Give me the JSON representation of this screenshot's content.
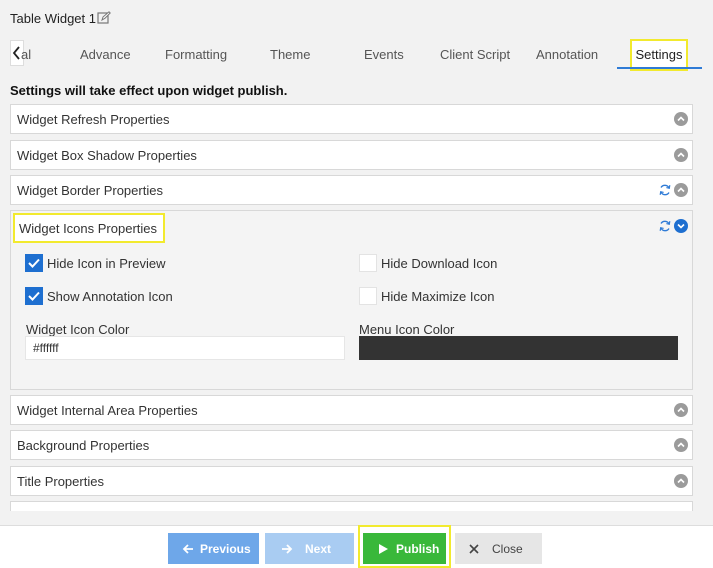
{
  "header": {
    "title": "Table Widget 1"
  },
  "tabs": {
    "partial": "al",
    "items": [
      {
        "label": "Advance"
      },
      {
        "label": "Formatting"
      },
      {
        "label": "Theme"
      },
      {
        "label": "Events"
      },
      {
        "label": "Client Script"
      },
      {
        "label": "Annotation"
      }
    ],
    "active": "Settings"
  },
  "notice": "Settings will take effect upon widget publish.",
  "panels": [
    {
      "label": "Widget Refresh Properties"
    },
    {
      "label": "Widget Box Shadow Properties"
    },
    {
      "label": "Widget Border Properties"
    },
    {
      "label": "Widget Icons Properties"
    },
    {
      "label": "Widget Internal Area Properties"
    },
    {
      "label": "Background Properties"
    },
    {
      "label": "Title Properties"
    }
  ],
  "icons_section": {
    "hide_icon_in_preview": {
      "label": "Hide Icon in Preview",
      "checked": true
    },
    "hide_download_icon": {
      "label": "Hide Download Icon",
      "checked": false
    },
    "show_annotation_icon": {
      "label": "Show Annotation Icon",
      "checked": true
    },
    "hide_maximize_icon": {
      "label": "Hide Maximize Icon",
      "checked": false
    },
    "widget_icon_color": {
      "label": "Widget Icon Color",
      "value": "#ffffff"
    },
    "menu_icon_color": {
      "label": "Menu Icon Color",
      "value": "#333333"
    }
  },
  "footer": {
    "previous": "Previous",
    "next": "Next",
    "publish": "Publish",
    "close": "Close"
  },
  "colors": {
    "accent": "#1e6fd0",
    "highlight": "#f2ea2e",
    "publish": "#39b83a",
    "previous": "#6ea7e9",
    "next": "#a9ccf2"
  }
}
